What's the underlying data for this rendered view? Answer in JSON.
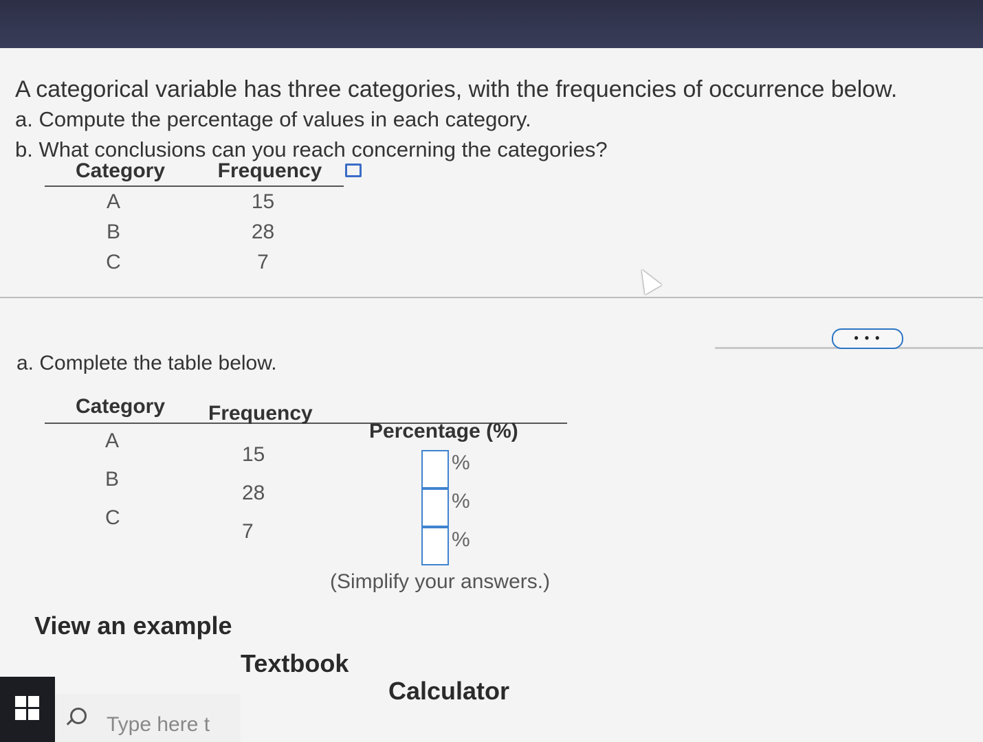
{
  "question": {
    "line1": "A categorical variable has three categories, with the frequencies of occurrence below.",
    "part_a": "a. Compute the percentage of values in each category.",
    "part_b": "b. What conclusions can you reach concerning the categories?"
  },
  "table1": {
    "headers": [
      "Category",
      "Frequency"
    ],
    "rows": [
      {
        "category": "A",
        "frequency": "15"
      },
      {
        "category": "B",
        "frequency": "28"
      },
      {
        "category": "C",
        "frequency": "7"
      }
    ]
  },
  "more_button": "• • •",
  "part_a_heading": "a. Complete the table below.",
  "table2": {
    "headers": [
      "Category",
      "Frequency",
      "Percentage (%)"
    ],
    "rows": [
      {
        "category": "A",
        "frequency": "15",
        "percent_value": "",
        "percent_sign": "%"
      },
      {
        "category": "B",
        "frequency": "28",
        "percent_value": "",
        "percent_sign": "%"
      },
      {
        "category": "C",
        "frequency": "7",
        "percent_value": "",
        "percent_sign": "%"
      }
    ]
  },
  "simplify_note": "(Simplify your answers.)",
  "links": {
    "example": "View an example",
    "textbook": "Textbook",
    "calculator": "Calculator"
  },
  "taskbar": {
    "search_placeholder": "Type here t"
  },
  "colors": {
    "accent": "#3f83cf",
    "topbar": "#2c2f45"
  }
}
